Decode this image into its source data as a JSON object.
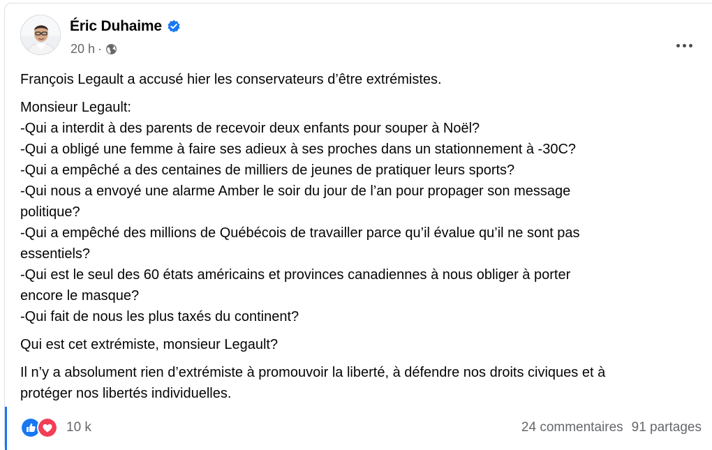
{
  "post": {
    "author": "Éric Duhaime",
    "time": "20 h",
    "separator": "·",
    "paragraphs": [
      [
        "François Legault a accusé hier les conservateurs d’être extrémistes."
      ],
      [
        "Monsieur Legault:",
        "-Qui a interdit à des parents de recevoir deux enfants pour souper à Noël?",
        "-Qui a obligé une femme à faire ses adieux à ses proches dans un stationnement à -30C?",
        "-Qui a empêché a des centaines de milliers de jeunes de pratiquer leurs sports?",
        "-Qui nous a envoyé une alarme Amber le soir du jour de l’an pour propager son message",
        "politique?",
        "-Qui a empêché des millions de Québécois de travailler parce qu’il évalue qu’il ne sont pas",
        "essentiels?",
        "-Qui est le seul des 60 états américains et provinces canadiennes à nous obliger à porter",
        "encore le masque?",
        "-Qui fait de nous les plus taxés du continent?"
      ],
      [
        "Qui est cet extrémiste, monsieur Legault?"
      ],
      [
        "Il n’y a absolument rien d’extrémiste à promouvoir la liberté, à défendre nos droits civiques et à",
        "protéger nos libertés individuelles."
      ]
    ]
  },
  "footer": {
    "reaction_count": "10 k",
    "comments": "24 commentaires",
    "shares": "91 partages"
  },
  "icons": {
    "verified": "verified-badge-icon",
    "audience": "globe-icon",
    "more": "more-options-icon",
    "like": "like-reaction-icon",
    "love": "love-reaction-icon"
  },
  "colors": {
    "accent": "#1877f2",
    "like": "#1877f2",
    "love": "#f33e58",
    "secondary_text": "#65676b",
    "primary_text": "#050505"
  }
}
